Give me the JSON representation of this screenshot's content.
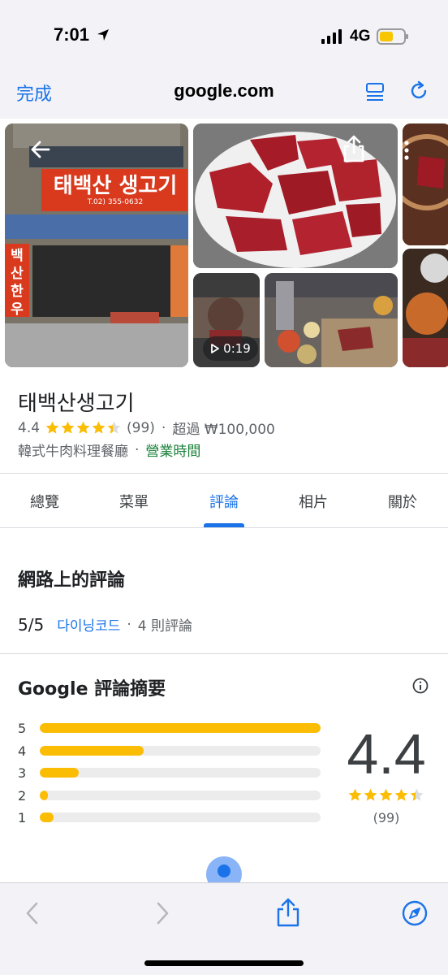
{
  "status": {
    "time": "7:01",
    "network": "4G"
  },
  "browser": {
    "done_label": "完成",
    "url": "google.com"
  },
  "gallery": {
    "storefront_sign": "태백산 생고기",
    "storefront_phone": "T.02) 355-0632",
    "side_sign": "백산 한우",
    "video_duration": "0:19"
  },
  "place": {
    "name": "태백산생고기",
    "rating": "4.4",
    "review_count": "(99)",
    "separator": "·",
    "price": "超過 ₩100,000",
    "category": "韓式牛肉料理餐廳",
    "hours_link": "營業時間"
  },
  "tabs": [
    {
      "label": "總覽"
    },
    {
      "label": "菜單"
    },
    {
      "label": "評論"
    },
    {
      "label": "相片"
    },
    {
      "label": "關於"
    }
  ],
  "web_reviews": {
    "title": "網路上的評論",
    "score": "5/5",
    "source": "다이닝코드",
    "count": "4 則評論"
  },
  "summary": {
    "title": "Google 評論摘要",
    "bars": [
      {
        "label": "5",
        "fraction": 1.0
      },
      {
        "label": "4",
        "fraction": 0.37
      },
      {
        "label": "3",
        "fraction": 0.14
      },
      {
        "label": "2",
        "fraction": 0.03
      },
      {
        "label": "1",
        "fraction": 0.05
      }
    ],
    "average": "4.4",
    "count": "(99)",
    "star_fill": 0.88
  },
  "colors": {
    "accent": "#1a73e8",
    "star": "#fbbc04",
    "open": "#188038"
  }
}
